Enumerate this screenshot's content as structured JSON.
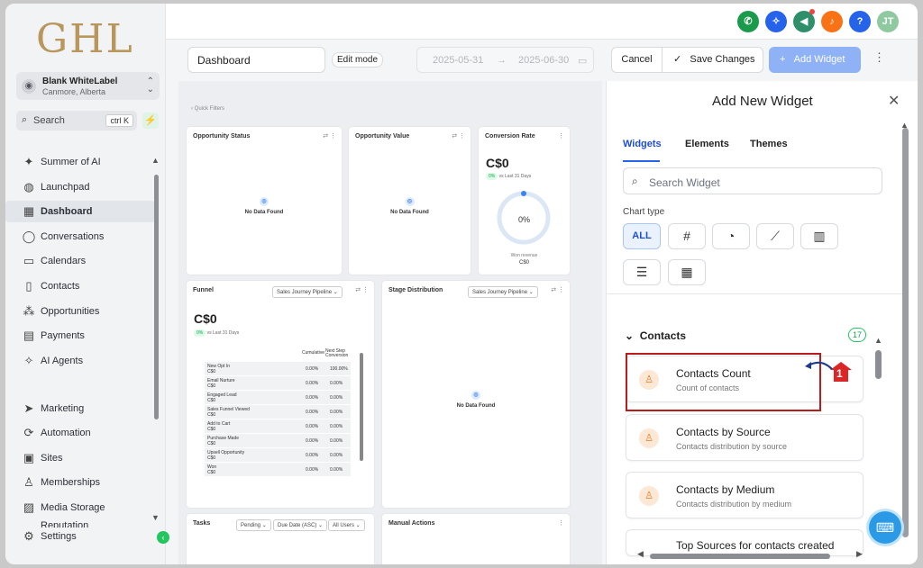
{
  "sidebar": {
    "logo": "GHL",
    "account_name": "Blank WhiteLabel",
    "account_location": "Canmore, Alberta",
    "search_label": "Search",
    "search_shortcut": "ctrl K",
    "items": [
      {
        "label": "Summer of AI",
        "icon": "sparkle-icon"
      },
      {
        "label": "Launchpad",
        "icon": "rocket-icon"
      },
      {
        "label": "Dashboard",
        "icon": "grid-icon",
        "active": true
      },
      {
        "label": "Conversations",
        "icon": "chat-icon"
      },
      {
        "label": "Calendars",
        "icon": "calendar-icon"
      },
      {
        "label": "Contacts",
        "icon": "contacts-icon"
      },
      {
        "label": "Opportunities",
        "icon": "opportunities-icon"
      },
      {
        "label": "Payments",
        "icon": "payments-icon"
      },
      {
        "label": "AI Agents",
        "icon": "ai-agents-icon"
      },
      {
        "label": "Marketing",
        "icon": "send-icon"
      },
      {
        "label": "Automation",
        "icon": "automation-icon"
      },
      {
        "label": "Sites",
        "icon": "sites-icon"
      },
      {
        "label": "Memberships",
        "icon": "membership-icon"
      },
      {
        "label": "Media Storage",
        "icon": "media-icon"
      },
      {
        "label": "Reputation",
        "icon": "reputation-icon"
      },
      {
        "label": "Settings",
        "icon": "gear-icon"
      }
    ]
  },
  "topbar": {
    "avatar_initials": "JT"
  },
  "toolbar": {
    "dashboard_name": "Dashboard",
    "edit_mode_label": "Edit mode",
    "date_start": "2025-05-31",
    "date_end": "2025-06-30",
    "cancel_label": "Cancel",
    "save_label": "Save Changes",
    "add_widget_label": "Add Widget"
  },
  "canvas": {
    "quick_filters": "Quick Filters",
    "opportunity_status": "Opportunity Status",
    "opportunity_value": "Opportunity Value",
    "conversion_rate": "Conversion Rate",
    "no_data": "No Data Found",
    "conv_value": "C$0",
    "conv_change": "0%",
    "vs_last": "vs Last 31 Days",
    "conv_percent": "0%",
    "won_revenue_label": "Won revenue",
    "won_revenue_value": "C$0",
    "funnel_title": "Funnel",
    "funnel_pipeline": "Sales Journey Pipeline",
    "funnel_value": "C$0",
    "funnel_col_cumulative": "Cumulative",
    "funnel_col_next": "Next Step Conversion",
    "funnel_rows": [
      {
        "name": "New Opt In",
        "value": "C$0",
        "cum": "0.00%",
        "next": "100.00%"
      },
      {
        "name": "Email Nurture",
        "value": "C$0",
        "cum": "0.00%",
        "next": "0.00%"
      },
      {
        "name": "Engaged Lead",
        "value": "C$0",
        "cum": "0.00%",
        "next": "0.00%"
      },
      {
        "name": "Sales Funnel Viewed",
        "value": "C$0",
        "cum": "0.00%",
        "next": "0.00%"
      },
      {
        "name": "Add to Cart",
        "value": "C$0",
        "cum": "0.00%",
        "next": "0.00%"
      },
      {
        "name": "Purchase Made",
        "value": "C$0",
        "cum": "0.00%",
        "next": "0.00%"
      },
      {
        "name": "Upsell Opportunity",
        "value": "C$0",
        "cum": "0.00%",
        "next": "0.00%"
      },
      {
        "name": "Won",
        "value": "C$0",
        "cum": "0.00%",
        "next": "0.00%"
      }
    ],
    "stage_title": "Stage Distribution",
    "stage_pipeline": "Sales Journey Pipeline",
    "tasks_title": "Tasks",
    "tasks_filter1": "Pending",
    "tasks_filter2": "Due Date (ASC)",
    "tasks_filter3": "All Users",
    "manual_actions_title": "Manual Actions"
  },
  "panel": {
    "title": "Add New Widget",
    "tabs": [
      "Widgets",
      "Elements",
      "Themes"
    ],
    "search_placeholder": "Search Widget",
    "chart_type_label": "Chart type",
    "chart_all_label": "ALL",
    "section_title": "Contacts",
    "section_count": "17",
    "marker_number": "1",
    "widgets": [
      {
        "title": "Contacts Count",
        "subtitle": "Count of contacts"
      },
      {
        "title": "Contacts by Source",
        "subtitle": "Contacts distribution by source"
      },
      {
        "title": "Contacts by Medium",
        "subtitle": "Contacts distribution by medium"
      },
      {
        "title": "Top Sources for contacts created",
        "subtitle": ""
      }
    ]
  },
  "colors": {
    "accent": "#2563eb",
    "highlight": "#b91c1c",
    "success": "#22c55e"
  }
}
